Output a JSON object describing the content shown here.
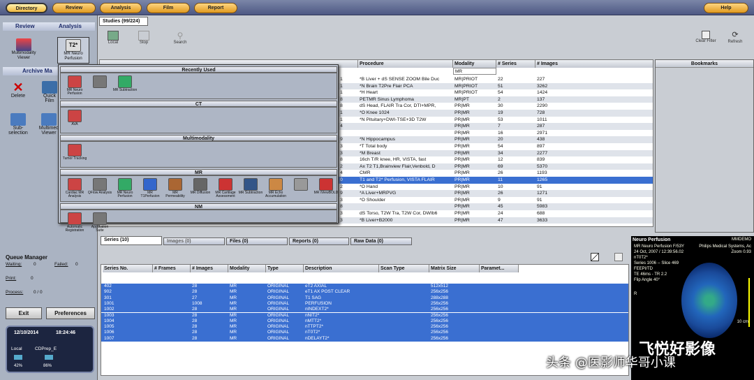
{
  "topnav": [
    "Directory",
    "Review",
    "Analysis",
    "Film",
    "Report",
    "Help"
  ],
  "left": {
    "review": "Review",
    "analysis": "Analysis",
    "mm_viewer": "Multimodality Viewer",
    "mr_neuro": "MR Neuro Perfusion",
    "archive": "Archive Ma",
    "delete": "Delete",
    "quickfilm": "Quick Film",
    "subsel": "Sub-selection",
    "mmviewer2": "Multimed Viewer"
  },
  "queue": {
    "title": "Queue Manager",
    "waiting": "Waiting:",
    "waiting_val": "0",
    "failed": "Failed:",
    "failed_val": "0",
    "print": "Print:",
    "print_val": "0",
    "process": "Process:",
    "process_val": "0 / 0"
  },
  "buttons": {
    "exit": "Exit",
    "prefs": "Preferences"
  },
  "clock": {
    "date": "12/10/2014",
    "time": "18:24:46",
    "local": "Local",
    "cdprep": "CDPrep_E",
    "local_pct": "42%",
    "cdprep_pct": "86%"
  },
  "studies": {
    "tab": "Studies (99/224)",
    "local": "Local",
    "stop": "Stop",
    "search": "Search",
    "clear": "Clear Filter",
    "refresh": "Refresh",
    "bookmarks": "Bookmarks"
  },
  "study_cols": [
    "Procedure",
    "Modality",
    "# Series",
    "# Images"
  ],
  "modality_filter": "MR",
  "studies_rows": [
    [
      "1",
      "*B Liver + dS  SENSE ZOOM Bile Duc",
      "MR|PRIOT",
      "22",
      "227"
    ],
    [
      "1",
      "*N Brain T2Pre Flair PCA",
      "MR|PRIOT",
      "51",
      "3262"
    ],
    [
      "1",
      "*H Heart",
      "MR|PRIOT",
      "54",
      "1424"
    ],
    [
      "8",
      "PETMR Sinus Lymphoma",
      "MR|PT",
      "2",
      "137"
    ],
    [
      "8",
      "dS Head, FLAIR Tra Cor, DTI+MPR,",
      "PR|MR",
      "30",
      "2290"
    ],
    [
      "1",
      "*O Knee 1024",
      "PR|MR",
      "19",
      "728"
    ],
    [
      "1",
      "*N Pituitary+DWI-TSE+3D T2W",
      "PR|MR",
      "53",
      "1011"
    ],
    [
      "4",
      "",
      "PR|MR",
      "7",
      "287"
    ],
    [
      "",
      "",
      "PR|MR",
      "16",
      "2971"
    ],
    [
      "9",
      "*N Hippocampus",
      "PR|MR",
      "20",
      "438"
    ],
    [
      "3",
      "*T Total body",
      "PR|MR",
      "54",
      "897"
    ],
    [
      "3",
      "*M Breast",
      "PR|MR",
      "34",
      "2277"
    ],
    [
      "8",
      "16ch T/R knee, HR, VISTA, fast",
      "PR|MR",
      "12",
      "839"
    ],
    [
      "2",
      "Ax T2 T1,Brainview Flair,Venbold, D",
      "PR|MR",
      "69",
      "5370"
    ],
    [
      "4",
      "CMR",
      "PR|MR",
      "26",
      "1193"
    ],
    [
      "0",
      "T1 and T2* Perfusion, VISTA FLAIR",
      "PR|MR",
      "11",
      "1265"
    ],
    [
      "2",
      "*O Hand",
      "PR|MR",
      "10",
      "91"
    ],
    [
      "9",
      "*A Liver+MRPVG",
      "PR|MR",
      "26",
      "1271"
    ],
    [
      "3",
      "*O Shoulder",
      "PR|MR",
      "9",
      "91"
    ],
    [
      "8",
      "",
      "PR|MR",
      "45",
      "5983"
    ],
    [
      "3",
      "dS Torso, T2W Tra, T2W Cor, DWIb6",
      "PR|MR",
      "24",
      "688"
    ],
    [
      "3",
      "*B Liver+B2000",
      "PR|MR",
      "47",
      "3633"
    ]
  ],
  "popup": {
    "recent": "Recently Used",
    "ct": "CT",
    "multi": "Multimodality",
    "mr": "MR",
    "nm": "NM",
    "recent_tools": [
      "MR Neuro Perfusion",
      "",
      "MR Subtraction"
    ],
    "ct_tools": [
      "AVA"
    ],
    "multi_tools": [
      "Tumor Tracking"
    ],
    "mr_tools": [
      "Cardiac MR Analysis",
      "QFlow Analysis",
      "MR Neuro Perfusion",
      "MR T1Perfusion",
      "MR Permeability",
      "MR Diffusion",
      "MR Cartilage Assessment",
      "MR Subtraction",
      "MR Echo Accumulation",
      "",
      "MR iViewBOLD"
    ],
    "nm_tools": [
      "Automatic Registration",
      "Application Suite"
    ]
  },
  "series_tabs": [
    "Series (10)",
    "Images (0)",
    "Files (0)",
    "Reports (0)",
    "Raw Data (0)"
  ],
  "series_cols": [
    "Series No.",
    "# Frames",
    "# Images",
    "Modality",
    "Type",
    "Description",
    "Scan Type",
    "Matrix Size",
    "Paramet..."
  ],
  "series_rows": [
    [
      "402",
      "",
      "28",
      "MR",
      "ORIGINAL",
      "eT2 AXIAL",
      "",
      "512x512"
    ],
    [
      "902",
      "",
      "28",
      "MR",
      "ORIGINAL",
      "eT1 AX POST CLEAR",
      "",
      "256x256"
    ],
    [
      "301",
      "",
      "27",
      "MR",
      "ORIGINAL",
      "T1 SAG",
      "",
      "288x288"
    ],
    [
      "1001",
      "",
      "1008",
      "MR",
      "ORIGINAL",
      "PERFUSION",
      "",
      "256x256"
    ],
    [
      "1002",
      "",
      "28",
      "MR",
      "ORIGINAL",
      "nINDEXT2*",
      "",
      "256x256"
    ],
    [
      "1003",
      "",
      "28",
      "MR",
      "ORIGINAL",
      "nNIT2*",
      "",
      "256x256"
    ],
    [
      "1004",
      "",
      "28",
      "MR",
      "ORIGINAL",
      "nMTT2*",
      "",
      "256x256"
    ],
    [
      "1005",
      "",
      "28",
      "MR",
      "ORIGINAL",
      "nTTPT2*",
      "",
      "256x256"
    ],
    [
      "1006",
      "",
      "28",
      "MR",
      "ORIGINAL",
      "nT0T2*",
      "",
      "256x256"
    ],
    [
      "1007",
      "",
      "28",
      "MR",
      "ORIGINAL",
      "nDELAYT2*",
      "",
      "256x256"
    ]
  ],
  "viewer": {
    "title": "Neuro Perfusion",
    "id": "MMDEMO",
    "line1": "MR Neuro Perfusion F/53Y",
    "line1b": "Philips Medical Systems, Ac",
    "line2": "24 Oct, 2007 / 12:39:56.02",
    "line2b": "Zoom 0.93",
    "line3": "nT0T2*",
    "line4": "Series 1006 -- Slice 469",
    "line5": "FEEPI/TD",
    "line6": "TE 46ms - TR 2.2",
    "line7": "Flip Angle 40°",
    "scale": "10 cm",
    "r": "R"
  },
  "watermark": {
    "a": "头条 @医影师华哥小课",
    "b": "飞悦好影像"
  },
  "colors": {
    "selected": "#3a6fd1",
    "accent": "#e09a20"
  }
}
